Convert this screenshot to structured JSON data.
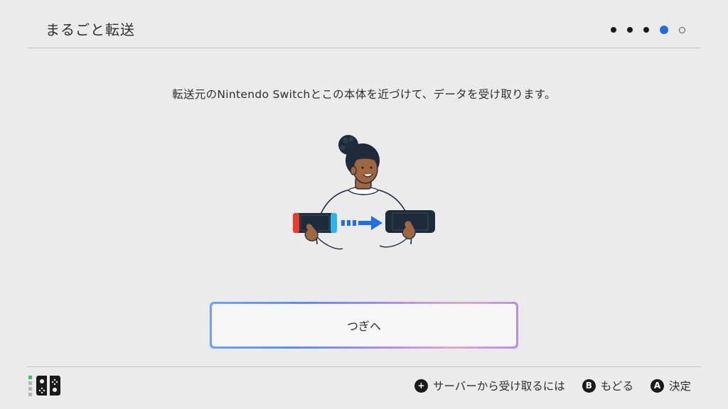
{
  "header": {
    "title": "まるごと転送",
    "steps": {
      "total": 5,
      "current": 4
    }
  },
  "body": {
    "instruction": "転送元のNintendo Switchとこの本体を近づけて、データを受け取ります。",
    "illustration_icon": "person-holding-two-consoles-transfer-icon"
  },
  "next_button": {
    "label": "つぎへ"
  },
  "footer": {
    "controller_icon": "joy-con-icon",
    "player_leds": [
      true,
      false,
      false,
      false
    ],
    "actions": [
      {
        "glyph": "+",
        "label": "サーバーから受け取るには"
      },
      {
        "glyph": "B",
        "label": "もどる"
      },
      {
        "glyph": "A",
        "label": "決定"
      }
    ]
  },
  "colors": {
    "accent_blue": "#1f6fe6",
    "background": "#ebebeb",
    "player_led_on": "#2fd13a",
    "joycon_red": "#ef3b24",
    "joycon_blue": "#29b6ef"
  }
}
